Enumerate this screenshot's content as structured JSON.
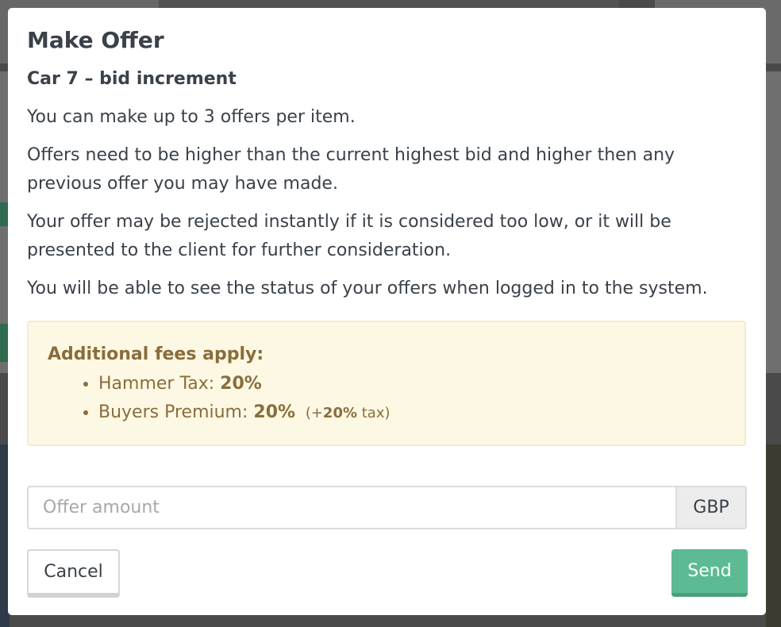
{
  "modal": {
    "title": "Make Offer",
    "subtitle": "Car 7 – bid increment",
    "paragraphs": [
      "You can make up to 3 offers per item.",
      "Offers need to be higher than the current highest bid and higher then any previous offer you may have made.",
      "Your offer may be rejected instantly if it is considered too low, or it will be presented to the client for further consideration.",
      "You will be able to see the status of your offers when logged in to the system."
    ],
    "fees": {
      "heading": "Additional fees apply:",
      "items": [
        {
          "label": "Hammer Tax:",
          "value": "20%"
        },
        {
          "label": "Buyers Premium:",
          "value": "20%",
          "extra_prefix": "(+",
          "extra_value": "20%",
          "extra_suffix": "tax)"
        }
      ]
    },
    "offer_input": {
      "placeholder": "Offer amount",
      "value": ""
    },
    "currency": "GBP",
    "cancel_label": "Cancel",
    "send_label": "Send"
  },
  "colors": {
    "send_button": "#5cbb95",
    "alert_bg": "#fcf8e3",
    "alert_text": "#8a6d3b"
  }
}
